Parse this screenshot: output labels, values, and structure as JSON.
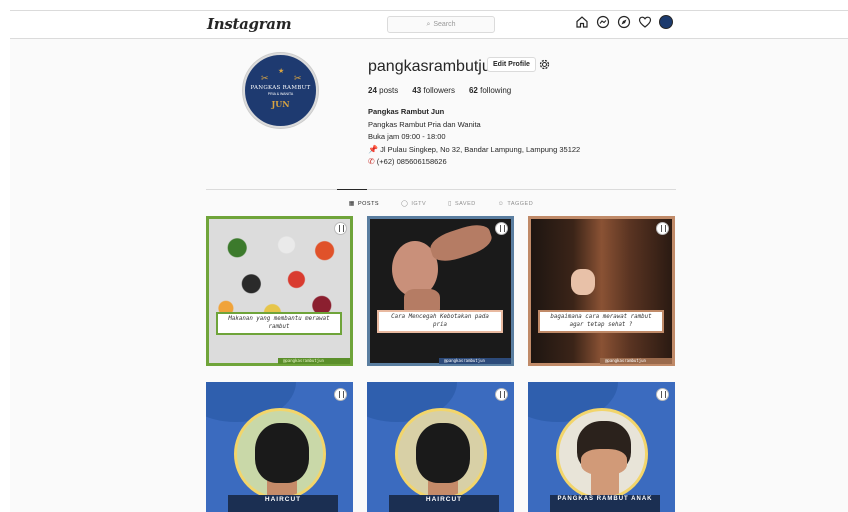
{
  "header": {
    "logo": "Instagram",
    "search_placeholder": "Search",
    "icons": [
      "home-icon",
      "messenger-icon",
      "explore-icon",
      "heart-icon",
      "profile-avatar"
    ]
  },
  "profile": {
    "username": "pangkasrambutjun",
    "edit_button": "Edit Profile",
    "stats": {
      "posts_count": "24",
      "posts_label": "posts",
      "followers_count": "43",
      "followers_label": "followers",
      "following_count": "62",
      "following_label": "following"
    },
    "bio": {
      "name": "Pangkas Rambut Jun",
      "line1": "Pangkas Rambut Pria dan Wanita",
      "line2": "Buka jam 09:00 - 18:00",
      "address": "Jl Pulau Singkep, No 32, Bandar Lampung, Lampung 35122",
      "phone": "(+62) 085606158626"
    },
    "avatar_logo": {
      "line1": "PANGKAS RAMBUT",
      "line2": "PRIA & WANITA",
      "line3": "JUN"
    }
  },
  "tabs": [
    {
      "label": "POSTS",
      "icon": "grid-icon",
      "active": true
    },
    {
      "label": "IGTV",
      "icon": "igtv-icon",
      "active": false
    },
    {
      "label": "SAVED",
      "icon": "bookmark-icon",
      "active": false
    },
    {
      "label": "TAGGED",
      "icon": "tag-icon",
      "active": false
    }
  ],
  "posts": [
    {
      "caption": "Makanan yang membantu merawat rambut",
      "handle": "@pangkasrambutjun",
      "frame_color": "#6fa43a"
    },
    {
      "caption": "Cara Mencegah Kebotakan pada pria",
      "handle": "@pangkasrambutjun",
      "frame_color": "#5a7ea0"
    },
    {
      "caption": "bagaimana cara merawat rambut agar tetap sehat ?",
      "handle": "@pangkasrambutjun",
      "frame_color": "#c08a68"
    },
    {
      "label": "HAIRCUT"
    },
    {
      "label": "HAIRCUT"
    },
    {
      "label": "PANGKAS RAMBUT ANAK"
    }
  ]
}
